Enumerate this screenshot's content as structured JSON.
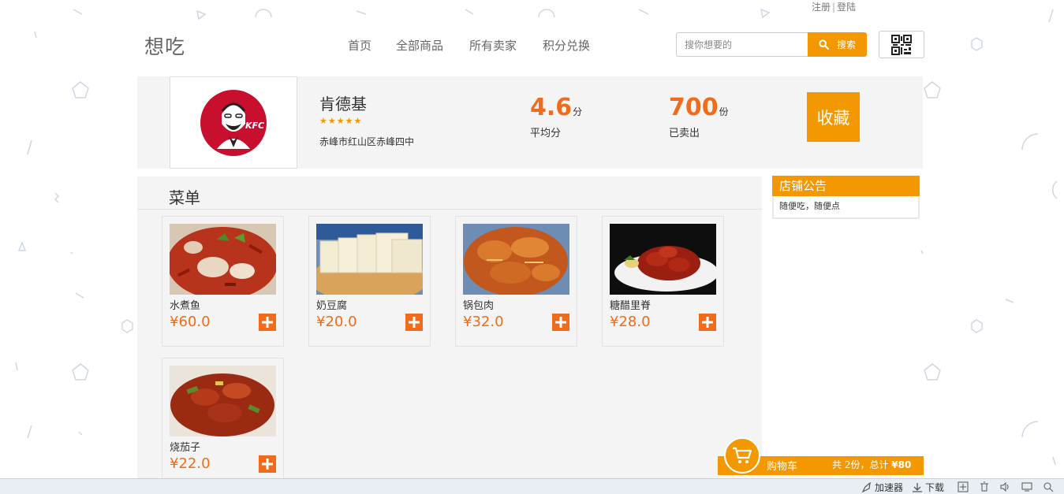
{
  "top_links": {
    "register": "注册",
    "separator": "|",
    "login": "登陆"
  },
  "header": {
    "logo": "想吃",
    "nav": [
      {
        "label": "首页"
      },
      {
        "label": "全部商品"
      },
      {
        "label": "所有卖家"
      },
      {
        "label": "积分兑换"
      }
    ],
    "search": {
      "placeholder": "搜你想要的",
      "button_label": "搜索"
    },
    "qr_icon": "qr-code-icon"
  },
  "store": {
    "logo_text": "KFC",
    "name": "肯德基",
    "stars": "★★★★★",
    "rating": 4.5,
    "address": "赤峰市红山区赤峰四中",
    "avg_score": {
      "value": "4.6",
      "unit": "分",
      "label": "平均分"
    },
    "sold": {
      "value": "700",
      "unit": "份",
      "label": "已卖出"
    },
    "favorite_label": "收藏"
  },
  "menu": {
    "title": "菜单",
    "items": [
      {
        "name": "水煮鱼",
        "price": "¥60.0"
      },
      {
        "name": "奶豆腐",
        "price": "¥20.0"
      },
      {
        "name": "锅包肉",
        "price": "¥32.0"
      },
      {
        "name": "糖醋里脊",
        "price": "¥28.0"
      },
      {
        "name": "烧茄子",
        "price": "¥22.0"
      }
    ]
  },
  "notice": {
    "title": "店铺公告",
    "content": "随便吃，随便点"
  },
  "cart": {
    "label": "购物车",
    "summary_prefix": "共 2份，总计",
    "total": "¥80"
  },
  "status_bar": {
    "accelerator": "加速器",
    "download": "下载"
  },
  "colors": {
    "accent": "#f39800",
    "price": "#f06c1a",
    "panel": "#f4f4f4"
  }
}
